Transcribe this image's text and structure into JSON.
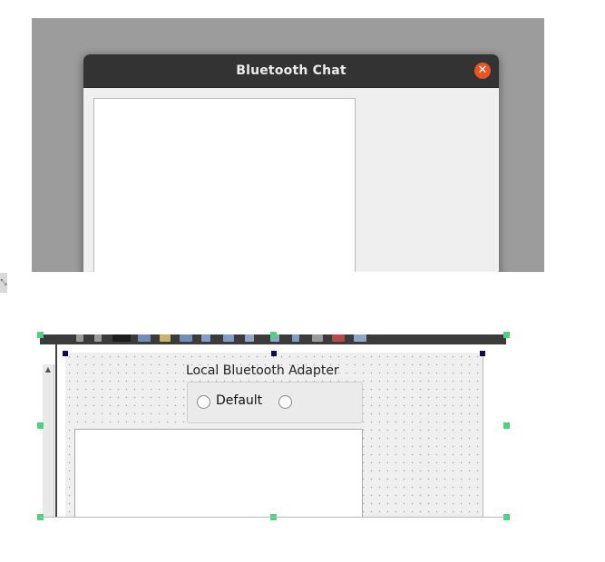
{
  "top_window": {
    "title": "Bluetooth Chat",
    "close_glyph": "✕",
    "accent_color": "#e95420"
  },
  "resize_glyph": "⤡",
  "designer": {
    "group_title": "Local Bluetooth Adapter",
    "radio_default_label": "Default",
    "radio_second_label": "",
    "scroll_up_glyph": "▲"
  },
  "colors": {
    "handle_green": "#4fcf80",
    "handle_navy": "#0b0b5a"
  }
}
